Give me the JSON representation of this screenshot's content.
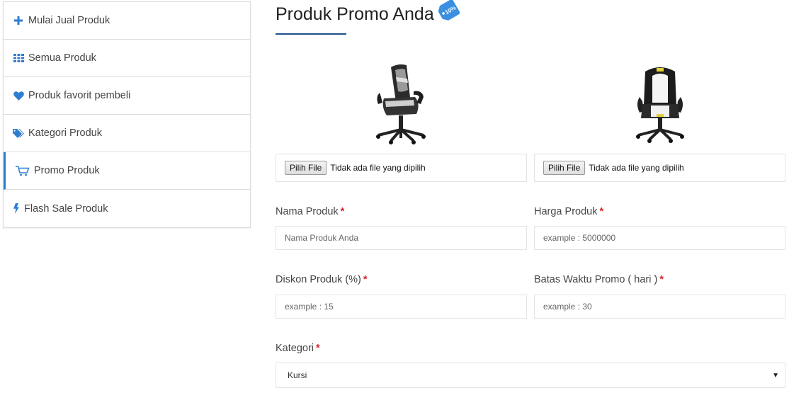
{
  "sidebar": {
    "items": [
      {
        "label": "Mulai Jual Produk",
        "icon": "plus-icon"
      },
      {
        "label": "Semua Produk",
        "icon": "grid-icon"
      },
      {
        "label": "Produk favorit pembeli",
        "icon": "heart-icon"
      },
      {
        "label": "Kategori Produk",
        "icon": "tags-icon"
      },
      {
        "label": "Promo Produk",
        "icon": "cart-icon",
        "active": true
      },
      {
        "label": "Flash Sale Produk",
        "icon": "bolt-icon"
      }
    ]
  },
  "main": {
    "title": "Produk Promo Anda",
    "title_icon": "discount-tag-icon",
    "tag_text": "10%",
    "uploads": [
      {
        "button": "Pilih File",
        "status": "Tidak ada file yang dipilih"
      },
      {
        "button": "Pilih File",
        "status": "Tidak ada file yang dipilih"
      }
    ],
    "form": {
      "name": {
        "label": "Nama Produk",
        "placeholder": "Nama Produk Anda"
      },
      "price": {
        "label": "Harga Produk",
        "placeholder": "example : 5000000"
      },
      "discount": {
        "label": "Diskon Produk (%)",
        "placeholder": "example : 15"
      },
      "duration": {
        "label": "Batas Waktu Promo ( hari )",
        "placeholder": "example : 30"
      },
      "category": {
        "label": "Kategori",
        "selected": "Kursi"
      },
      "required_mark": "*"
    }
  },
  "colors": {
    "accent": "#2f7dd1",
    "title_underline": "#1f4e8c",
    "required": "#d9262b",
    "border": "#e3e3e3"
  }
}
